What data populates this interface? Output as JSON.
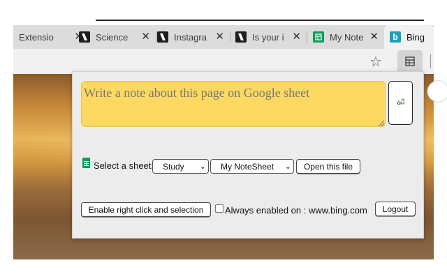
{
  "tabs": [
    {
      "title": "Extensio",
      "icon": "none",
      "close": "✕"
    },
    {
      "title": "Science",
      "icon": "bookmark-app-icon",
      "close": "✕"
    },
    {
      "title": "Instagra",
      "icon": "bookmark-app-icon",
      "close": "✕"
    },
    {
      "title": "Is your i",
      "icon": "bookmark-app-icon",
      "close": "✕"
    },
    {
      "title": "My Note",
      "icon": "google-sheets-icon",
      "close": "✕"
    },
    {
      "title": "Bing",
      "icon": "bing-icon",
      "close": ""
    }
  ],
  "toolbar": {
    "star_icon": "star-icon",
    "extension_icon": "sheet-extension-icon"
  },
  "popup": {
    "note_placeholder": "Write a note about this page on Google sheet",
    "enter_glyph": "⏎",
    "select_label": "Select a sheet:",
    "sheet_select": "Study",
    "file_select": "My NoteSheet",
    "open_file": "Open this file",
    "enable_right_click": "Enable right click and selection",
    "always_enabled": "Always enabled on : www.bing.com",
    "logout": "Logout"
  },
  "colors": {
    "note_bg": "#fdd962",
    "popup_bg": "#ececec",
    "sheets_green": "#0f9d58"
  }
}
